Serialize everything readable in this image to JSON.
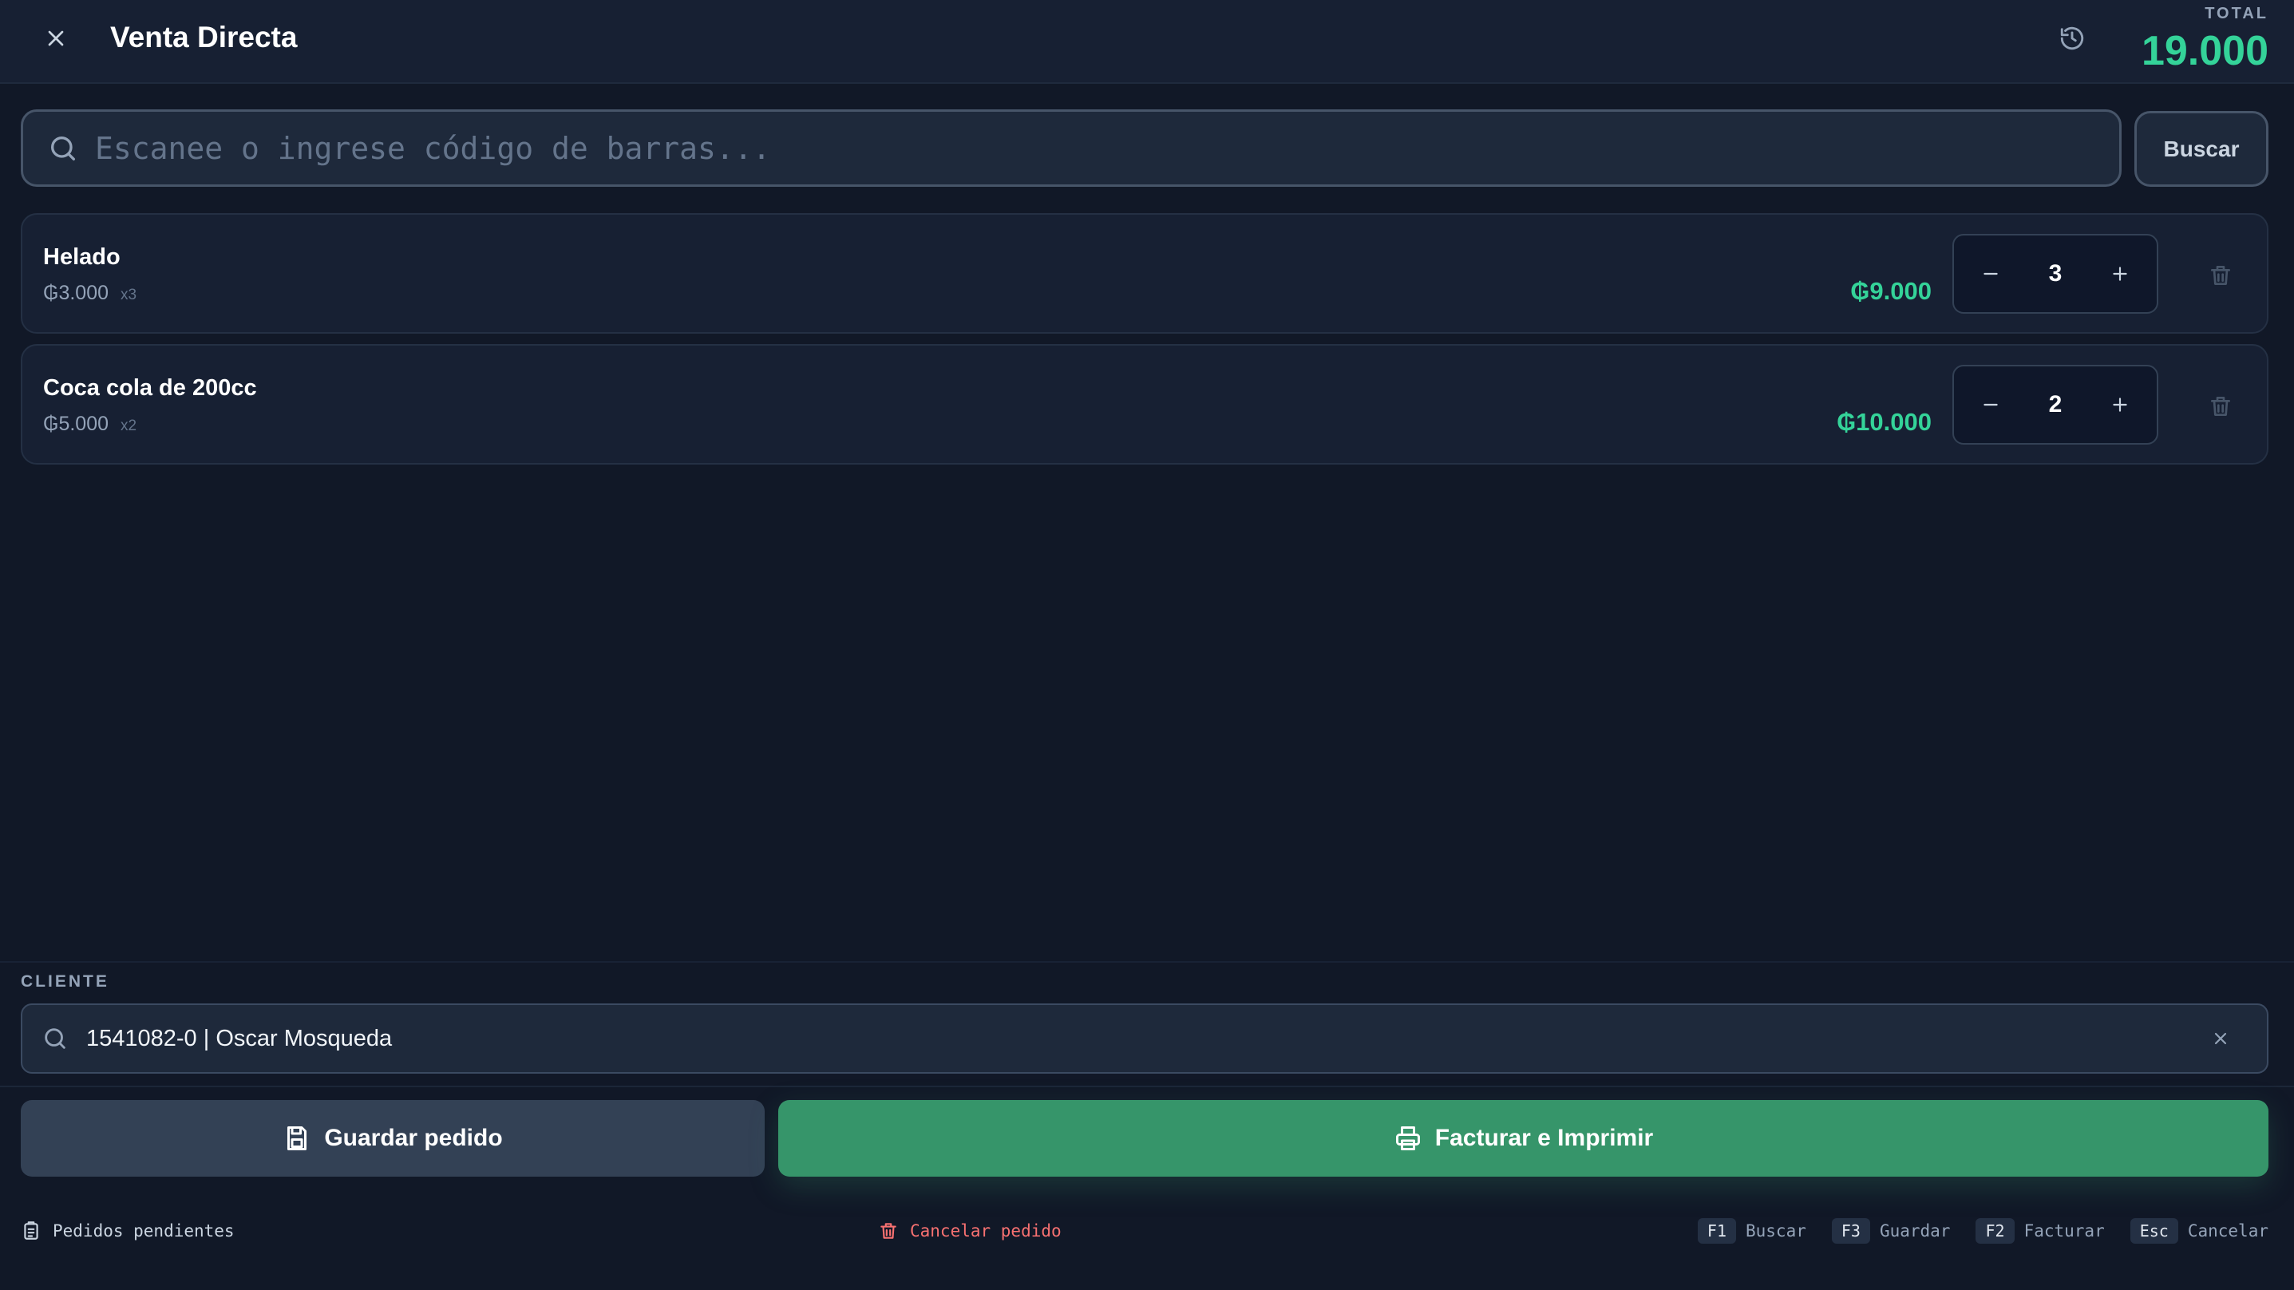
{
  "header": {
    "title": "Venta Directa",
    "total_label": "TOTAL",
    "total_value": "19.000"
  },
  "search": {
    "placeholder": "Escanee o ingrese código de barras...",
    "button_label": "Buscar"
  },
  "items": [
    {
      "name": "Helado",
      "unit_price": "₲3.000",
      "qty_label": "x3",
      "subtotal": "₲9.000",
      "quantity": "3"
    },
    {
      "name": "Coca cola de 200cc",
      "unit_price": "₲5.000",
      "qty_label": "x2",
      "subtotal": "₲10.000",
      "quantity": "2"
    }
  ],
  "client": {
    "label": "CLIENTE",
    "value": "1541082-0 | Oscar Mosqueda"
  },
  "actions": {
    "save_label": "Guardar pedido",
    "bill_label": "Facturar e Imprimir"
  },
  "footer": {
    "pending_label": "Pedidos pendientes",
    "cancel_label": "Cancelar pedido",
    "shortcuts": [
      {
        "key": "F1",
        "label": "Buscar"
      },
      {
        "key": "F3",
        "label": "Guardar"
      },
      {
        "key": "F2",
        "label": "Facturar"
      },
      {
        "key": "Esc",
        "label": "Cancelar"
      }
    ]
  },
  "colors": {
    "background": "#111827",
    "accent_green": "#34d399",
    "bill_button": "#36956a",
    "save_button": "#334155",
    "danger": "#f87171"
  }
}
